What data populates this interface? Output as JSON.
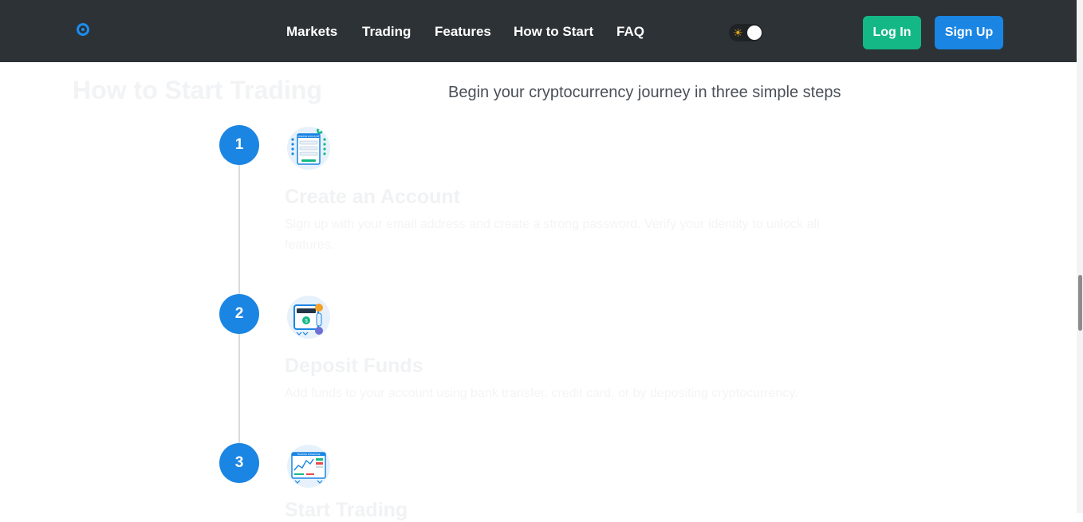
{
  "header": {
    "logo": "circle-logo-icon",
    "nav": [
      "Markets",
      "Trading",
      "Features",
      "How to Start",
      "FAQ"
    ],
    "theme_toggle_icon": "sun-icon",
    "login_label": "Log In",
    "signup_label": "Sign Up"
  },
  "colors": {
    "navbar_bg": "#2c3236",
    "primary_blue": "#1a85e3",
    "login_green": "#14b887"
  },
  "main": {
    "title": "How to Start Trading",
    "subtitle": "Begin your cryptocurrency journey in three simple steps",
    "steps": [
      {
        "number": "1",
        "icon": "create-account-form-icon",
        "icon_text": "CREATE ACCOUNT",
        "title": "Create an Account",
        "description": "Sign up with your email address and create a strong password. Verify your identity to unlock all features."
      },
      {
        "number": "2",
        "icon": "wallet-deposit-icon",
        "title": "Deposit Funds",
        "description": "Add funds to your account using bank transfer, credit card, or by depositing cryptocurrency."
      },
      {
        "number": "3",
        "icon": "trading-chart-icon",
        "icon_text": "TRADING INTERFACE",
        "title": "Start Trading",
        "description": ""
      }
    ]
  }
}
